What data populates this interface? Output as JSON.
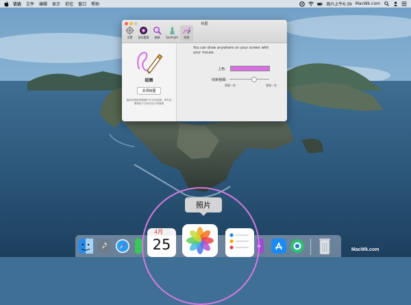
{
  "menubar": {
    "app": "访达",
    "items": [
      "文件",
      "编辑",
      "显示",
      "前往",
      "窗口",
      "帮助"
    ],
    "clock": "周六上午6:39",
    "site": "MacWk.com",
    "icons": [
      "apple-icon",
      "search-status-icon",
      "wifi-icon",
      "battery-icon",
      "spotlight-icon",
      "user-icon",
      "control-center-icon"
    ]
  },
  "window": {
    "title": "绘图",
    "toolbar": [
      {
        "label": "设置",
        "icon": "gear-icon"
      },
      {
        "label": "鼠标看看",
        "icon": "mouse-lens-icon"
      },
      {
        "label": "缩放",
        "icon": "magnifier-icon"
      },
      {
        "label": "Spotlight",
        "icon": "spotlight-tool-icon"
      },
      {
        "label": "绘图",
        "icon": "draw-icon"
      }
    ],
    "left": {
      "name": "绘图",
      "button": "关闭绘图",
      "hint": "重新排键盘快捷键打开/关闭绘图。请在设置面板下自用自定义快捷键"
    },
    "right": {
      "description": "You can draw anywhere on your screen with your mouse.",
      "color_label": "上色:",
      "color_value": "#da6fe3",
      "width_label": "线条粗细:",
      "width_level": 0.63,
      "thin": "更细一些",
      "thick": "更粗一些"
    }
  },
  "dock": {
    "tooltip": "照片",
    "calendar": {
      "month": "4月",
      "day": "25"
    },
    "apps": [
      "finder-icon",
      "launchpad-icon",
      "safari-icon",
      "messages-icon",
      "calendar-icon",
      "photos-icon",
      "reminders-icon",
      "podcasts-icon",
      "app-store-icon",
      "system-icon",
      "trash-icon"
    ]
  },
  "colors": {
    "accent": "#da6fe3",
    "sea": "#2e5a7c",
    "sky": "#8fb8d8"
  },
  "watermark": "MacWk.com"
}
